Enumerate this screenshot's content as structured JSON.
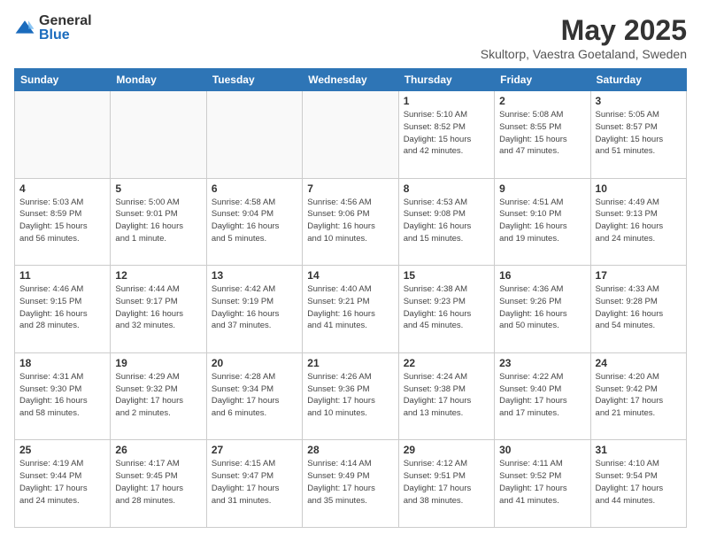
{
  "header": {
    "logo_general": "General",
    "logo_blue": "Blue",
    "title": "May 2025",
    "subtitle": "Skultorp, Vaestra Goetaland, Sweden"
  },
  "days_of_week": [
    "Sunday",
    "Monday",
    "Tuesday",
    "Wednesday",
    "Thursday",
    "Friday",
    "Saturday"
  ],
  "weeks": [
    [
      {
        "day": "",
        "info": ""
      },
      {
        "day": "",
        "info": ""
      },
      {
        "day": "",
        "info": ""
      },
      {
        "day": "",
        "info": ""
      },
      {
        "day": "1",
        "info": "Sunrise: 5:10 AM\nSunset: 8:52 PM\nDaylight: 15 hours\nand 42 minutes."
      },
      {
        "day": "2",
        "info": "Sunrise: 5:08 AM\nSunset: 8:55 PM\nDaylight: 15 hours\nand 47 minutes."
      },
      {
        "day": "3",
        "info": "Sunrise: 5:05 AM\nSunset: 8:57 PM\nDaylight: 15 hours\nand 51 minutes."
      }
    ],
    [
      {
        "day": "4",
        "info": "Sunrise: 5:03 AM\nSunset: 8:59 PM\nDaylight: 15 hours\nand 56 minutes."
      },
      {
        "day": "5",
        "info": "Sunrise: 5:00 AM\nSunset: 9:01 PM\nDaylight: 16 hours\nand 1 minute."
      },
      {
        "day": "6",
        "info": "Sunrise: 4:58 AM\nSunset: 9:04 PM\nDaylight: 16 hours\nand 5 minutes."
      },
      {
        "day": "7",
        "info": "Sunrise: 4:56 AM\nSunset: 9:06 PM\nDaylight: 16 hours\nand 10 minutes."
      },
      {
        "day": "8",
        "info": "Sunrise: 4:53 AM\nSunset: 9:08 PM\nDaylight: 16 hours\nand 15 minutes."
      },
      {
        "day": "9",
        "info": "Sunrise: 4:51 AM\nSunset: 9:10 PM\nDaylight: 16 hours\nand 19 minutes."
      },
      {
        "day": "10",
        "info": "Sunrise: 4:49 AM\nSunset: 9:13 PM\nDaylight: 16 hours\nand 24 minutes."
      }
    ],
    [
      {
        "day": "11",
        "info": "Sunrise: 4:46 AM\nSunset: 9:15 PM\nDaylight: 16 hours\nand 28 minutes."
      },
      {
        "day": "12",
        "info": "Sunrise: 4:44 AM\nSunset: 9:17 PM\nDaylight: 16 hours\nand 32 minutes."
      },
      {
        "day": "13",
        "info": "Sunrise: 4:42 AM\nSunset: 9:19 PM\nDaylight: 16 hours\nand 37 minutes."
      },
      {
        "day": "14",
        "info": "Sunrise: 4:40 AM\nSunset: 9:21 PM\nDaylight: 16 hours\nand 41 minutes."
      },
      {
        "day": "15",
        "info": "Sunrise: 4:38 AM\nSunset: 9:23 PM\nDaylight: 16 hours\nand 45 minutes."
      },
      {
        "day": "16",
        "info": "Sunrise: 4:36 AM\nSunset: 9:26 PM\nDaylight: 16 hours\nand 50 minutes."
      },
      {
        "day": "17",
        "info": "Sunrise: 4:33 AM\nSunset: 9:28 PM\nDaylight: 16 hours\nand 54 minutes."
      }
    ],
    [
      {
        "day": "18",
        "info": "Sunrise: 4:31 AM\nSunset: 9:30 PM\nDaylight: 16 hours\nand 58 minutes."
      },
      {
        "day": "19",
        "info": "Sunrise: 4:29 AM\nSunset: 9:32 PM\nDaylight: 17 hours\nand 2 minutes."
      },
      {
        "day": "20",
        "info": "Sunrise: 4:28 AM\nSunset: 9:34 PM\nDaylight: 17 hours\nand 6 minutes."
      },
      {
        "day": "21",
        "info": "Sunrise: 4:26 AM\nSunset: 9:36 PM\nDaylight: 17 hours\nand 10 minutes."
      },
      {
        "day": "22",
        "info": "Sunrise: 4:24 AM\nSunset: 9:38 PM\nDaylight: 17 hours\nand 13 minutes."
      },
      {
        "day": "23",
        "info": "Sunrise: 4:22 AM\nSunset: 9:40 PM\nDaylight: 17 hours\nand 17 minutes."
      },
      {
        "day": "24",
        "info": "Sunrise: 4:20 AM\nSunset: 9:42 PM\nDaylight: 17 hours\nand 21 minutes."
      }
    ],
    [
      {
        "day": "25",
        "info": "Sunrise: 4:19 AM\nSunset: 9:44 PM\nDaylight: 17 hours\nand 24 minutes."
      },
      {
        "day": "26",
        "info": "Sunrise: 4:17 AM\nSunset: 9:45 PM\nDaylight: 17 hours\nand 28 minutes."
      },
      {
        "day": "27",
        "info": "Sunrise: 4:15 AM\nSunset: 9:47 PM\nDaylight: 17 hours\nand 31 minutes."
      },
      {
        "day": "28",
        "info": "Sunrise: 4:14 AM\nSunset: 9:49 PM\nDaylight: 17 hours\nand 35 minutes."
      },
      {
        "day": "29",
        "info": "Sunrise: 4:12 AM\nSunset: 9:51 PM\nDaylight: 17 hours\nand 38 minutes."
      },
      {
        "day": "30",
        "info": "Sunrise: 4:11 AM\nSunset: 9:52 PM\nDaylight: 17 hours\nand 41 minutes."
      },
      {
        "day": "31",
        "info": "Sunrise: 4:10 AM\nSunset: 9:54 PM\nDaylight: 17 hours\nand 44 minutes."
      }
    ]
  ]
}
